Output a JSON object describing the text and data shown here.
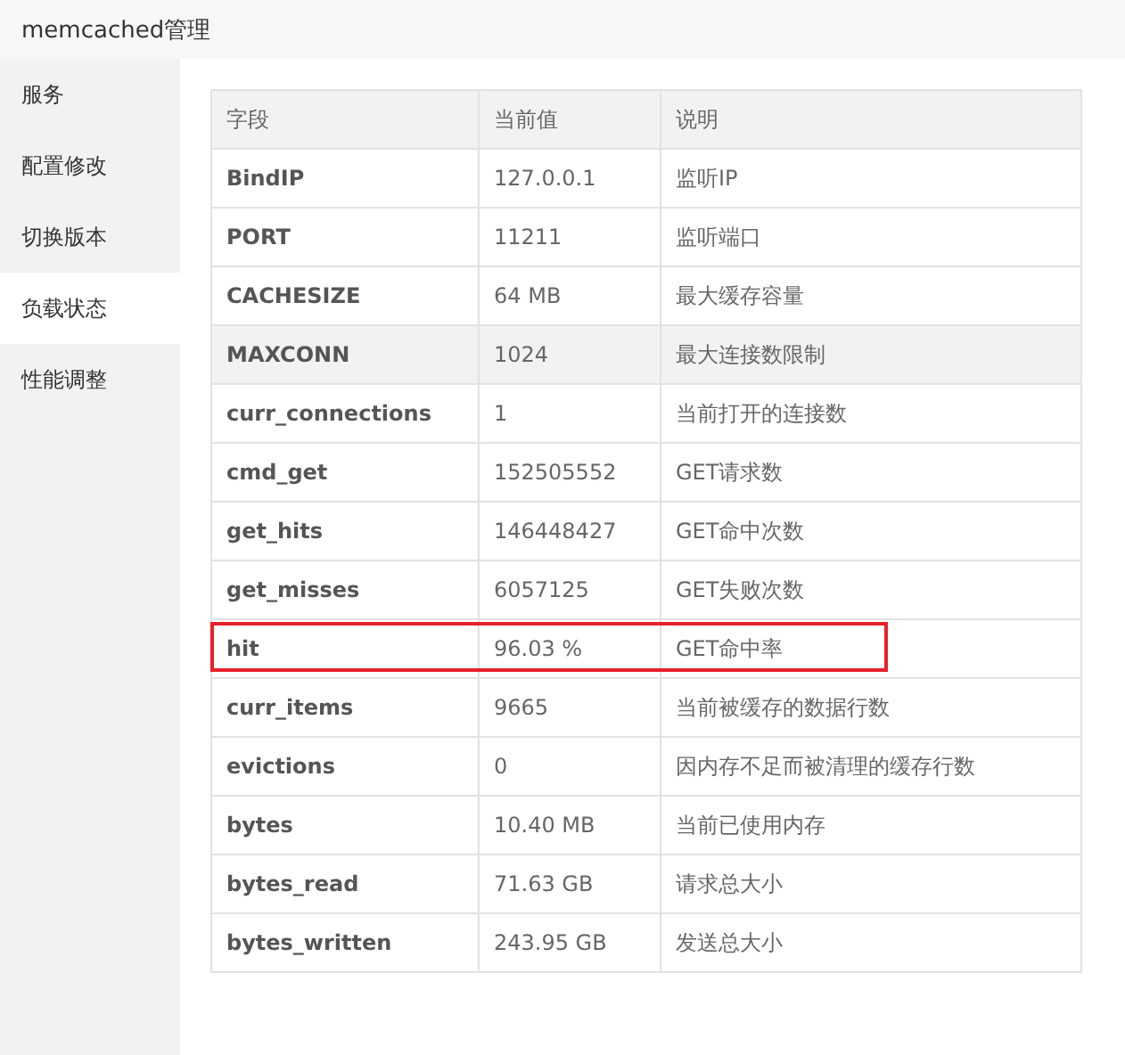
{
  "header": {
    "title": "memcached管理"
  },
  "sidebar": {
    "items": [
      {
        "label": "服务",
        "selected": false
      },
      {
        "label": "配置修改",
        "selected": false
      },
      {
        "label": "切换版本",
        "selected": false
      },
      {
        "label": "负载状态",
        "selected": true
      },
      {
        "label": "性能调整",
        "selected": false
      }
    ]
  },
  "table": {
    "columns": [
      "字段",
      "当前值",
      "说明"
    ],
    "rows": [
      {
        "field": "BindIP",
        "value": "127.0.0.1",
        "description": "监听IP",
        "highlighted": false,
        "marked": false
      },
      {
        "field": "PORT",
        "value": "11211",
        "description": "监听端口",
        "highlighted": false,
        "marked": false
      },
      {
        "field": "CACHESIZE",
        "value": "64 MB",
        "description": "最大缓存容量",
        "highlighted": false,
        "marked": false
      },
      {
        "field": "MAXCONN",
        "value": "1024",
        "description": "最大连接数限制",
        "highlighted": true,
        "marked": false
      },
      {
        "field": "curr_connections",
        "value": "1",
        "description": "当前打开的连接数",
        "highlighted": false,
        "marked": false
      },
      {
        "field": "cmd_get",
        "value": "152505552",
        "description": "GET请求数",
        "highlighted": false,
        "marked": false
      },
      {
        "field": "get_hits",
        "value": "146448427",
        "description": "GET命中次数",
        "highlighted": false,
        "marked": false
      },
      {
        "field": "get_misses",
        "value": "6057125",
        "description": "GET失败次数",
        "highlighted": false,
        "marked": false
      },
      {
        "field": "hit",
        "value": "96.03 %",
        "description": "GET命中率",
        "highlighted": false,
        "marked": true
      },
      {
        "field": "curr_items",
        "value": "9665",
        "description": "当前被缓存的数据行数",
        "highlighted": false,
        "marked": false
      },
      {
        "field": "evictions",
        "value": "0",
        "description": "因内存不足而被清理的缓存行数",
        "highlighted": false,
        "marked": false
      },
      {
        "field": "bytes",
        "value": "10.40 MB",
        "description": "当前已使用内存",
        "highlighted": false,
        "marked": false
      },
      {
        "field": "bytes_read",
        "value": "71.63 GB",
        "description": "请求总大小",
        "highlighted": false,
        "marked": false
      },
      {
        "field": "bytes_written",
        "value": "243.95 GB",
        "description": "发送总大小",
        "highlighted": false,
        "marked": false
      }
    ]
  }
}
